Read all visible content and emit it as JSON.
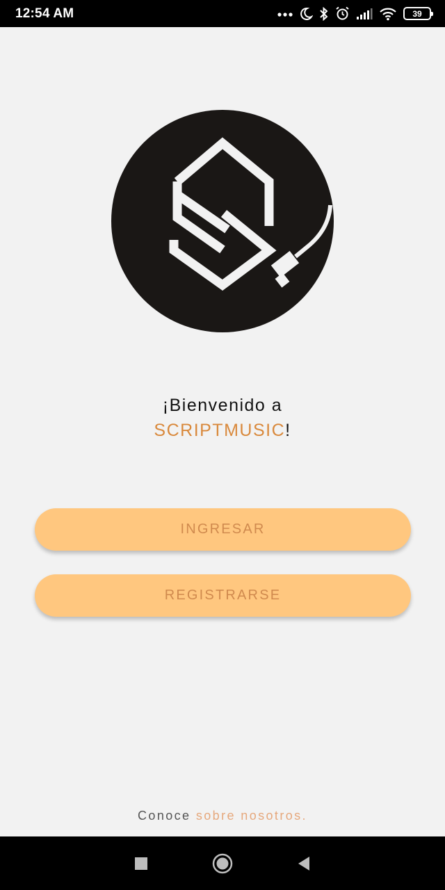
{
  "status_bar": {
    "time": "12:54 AM",
    "battery_level": "39",
    "icons": [
      "more-dots-icon",
      "moon-icon",
      "bluetooth-icon",
      "alarm-icon",
      "signal-icon",
      "wifi-icon",
      "battery-icon"
    ]
  },
  "logo": {
    "icon": "scriptmusic-logo-icon",
    "background": "#1a1715",
    "foreground": "#f2f2f2"
  },
  "welcome": {
    "line1": "¡Bienvenido a",
    "brand": "SCRIPTMUSIC",
    "exclamation": "!"
  },
  "buttons": {
    "login_label": "INGRESAR",
    "register_label": "REGISTRARSE"
  },
  "footer": {
    "prefix": "Conoce ",
    "link": "sobre nosotros."
  },
  "nav_bar": {
    "icons": [
      "recents-square-icon",
      "home-circle-icon",
      "back-triangle-icon"
    ]
  },
  "colors": {
    "accent": "#d9893c",
    "button_bg": "#ffc77f",
    "button_text": "#d08a4e",
    "link": "#e6a87c",
    "background": "#f2f2f2"
  }
}
